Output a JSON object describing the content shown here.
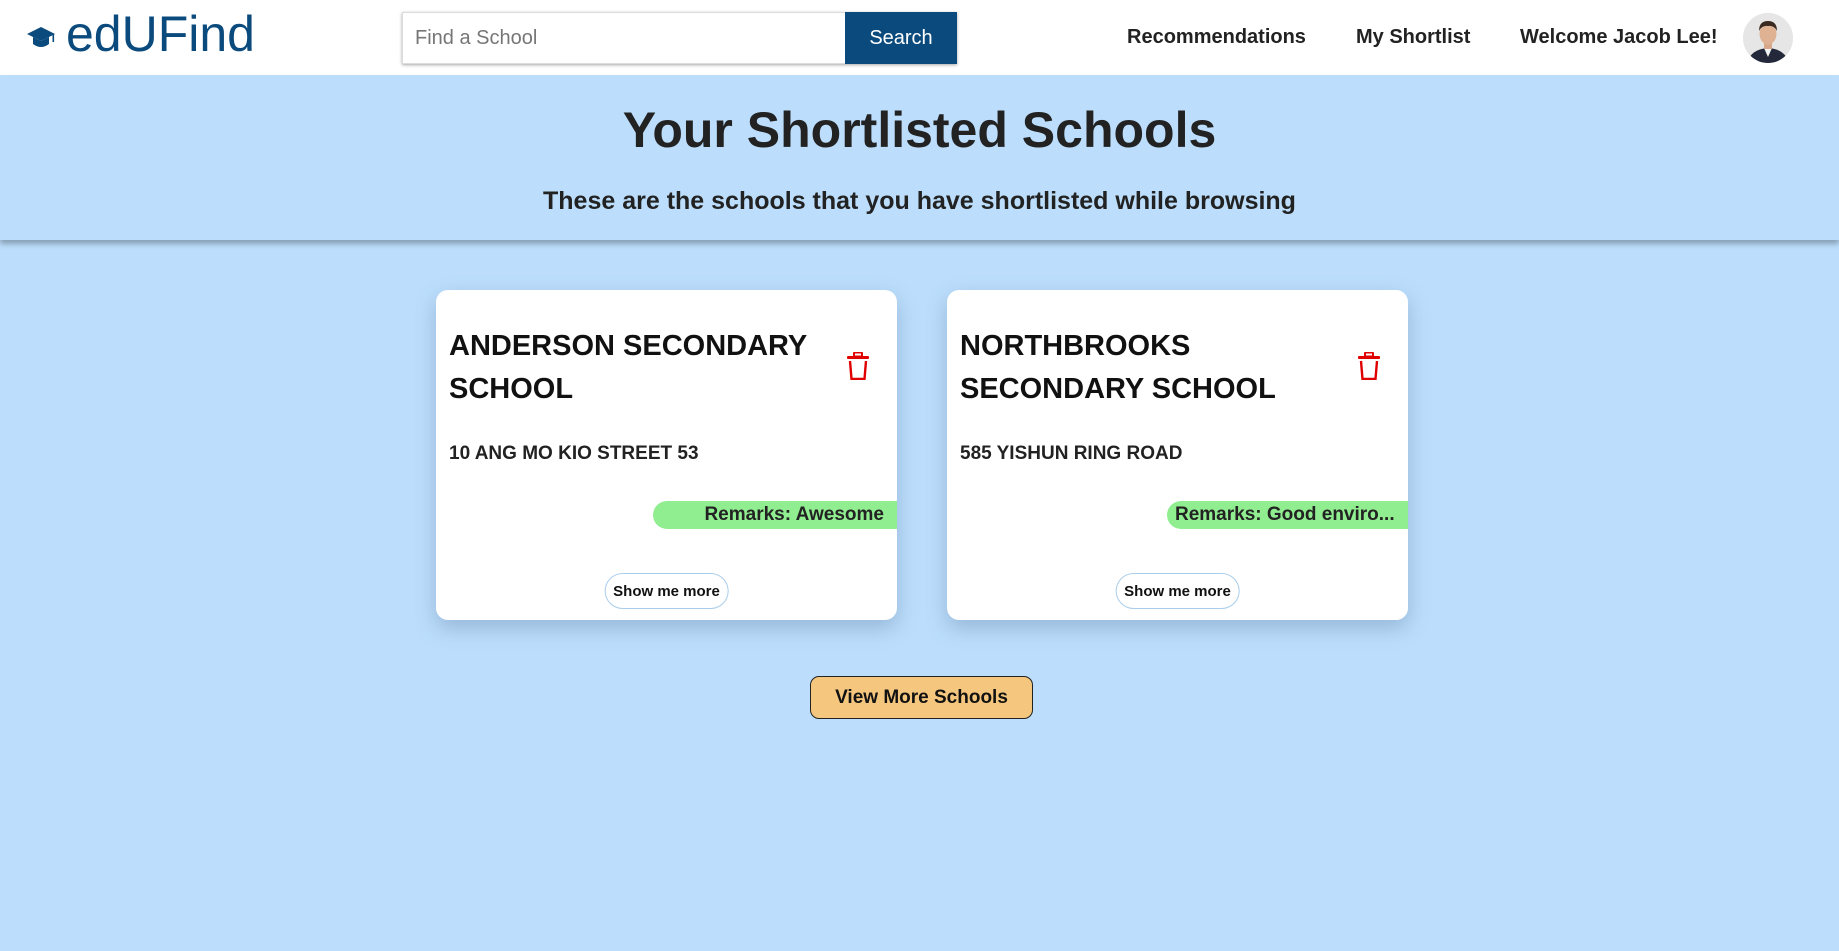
{
  "navbar": {
    "brand": "edUFind",
    "brand_icon": "graduation-cap-icon",
    "search": {
      "placeholder": "Find a School",
      "value": "",
      "button_label": "Search"
    },
    "links": {
      "recommendations": "Recommendations",
      "shortlist": "My Shortlist"
    },
    "welcome": "Welcome Jacob Lee!",
    "avatar": "user-avatar"
  },
  "header": {
    "title": "Your Shortlisted Schools",
    "subtitle": "These are the schools that you have shortlisted while browsing"
  },
  "cards": [
    {
      "name": "ANDERSON SECONDARY SCHOOL",
      "address": "10 ANG MO KIO STREET 53",
      "remarks": "Remarks: Awesome",
      "button_label": "Show me more",
      "delete_icon": "trash-icon"
    },
    {
      "name": "NORTHBROOKS SECONDARY SCHOOL",
      "address": "585 YISHUN RING ROAD",
      "remarks": "Remarks: Good enviro...",
      "button_label": "Show me more",
      "delete_icon": "trash-icon"
    }
  ],
  "view_more_label": "View More Schools",
  "colors": {
    "brand": "#0b4a7d",
    "background": "#bcdefc",
    "remarks_bg": "#90ee90",
    "delete": "#e00000",
    "view_more_bg": "#f5c77e"
  }
}
